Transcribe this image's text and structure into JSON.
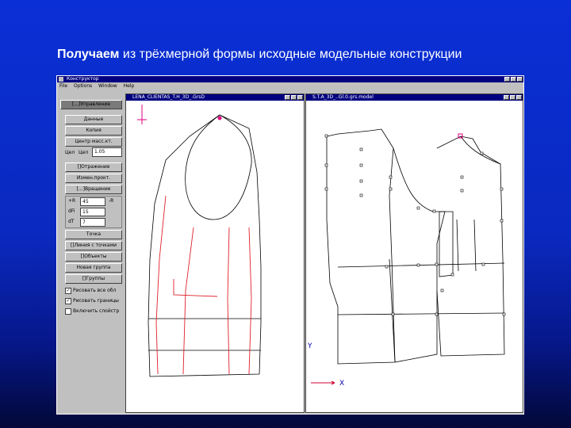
{
  "slide": {
    "title_bold": "Получаем",
    "title_rest": "из трёхмерной формы исходные модельные конструкции"
  },
  "app": {
    "window_title": "Конструктор",
    "menu": [
      "File",
      "Options",
      "Window",
      "Help"
    ],
    "left_view_title": "LENA_CLIENTAS_T.H_3D_.GrsD",
    "right_view_title": "S.T.A_3D_..Gl.0.grs.model"
  },
  "panel": {
    "management": "[...]Управление",
    "data": "Данные",
    "copy": "Копия",
    "center_mass": "Центр масс.кт.",
    "scale_label1": "Цел",
    "scale_label2": "Цел",
    "scale_value": "1.05",
    "reflection": "[]Отражение",
    "change_direction": "Измен.прокт.",
    "rotation": "[...]Вращение",
    "plus_r": "+R",
    "minus_r": "-R",
    "r_value": "45",
    "dfi_label": "dFi",
    "dfi_value": "15",
    "dt_label": "dT",
    "dt_value": "7",
    "point": "Точка",
    "line_by_points": "[]Линия с точками",
    "objects": "[]Объекты",
    "new_group": "Новая группа",
    "groups": "[]Группы",
    "check_draw_objects": "Рисовать все обл",
    "check_draw_borders": "Рисовать границы",
    "check_include_layers": "Включить слойстр"
  },
  "axes": {
    "y_label": "Y",
    "x_label": "X",
    "x_arrow_color": "#cc0033"
  },
  "colors": {
    "construction_line": "#000000",
    "model_line": "#e0202a",
    "marker": "#e00080"
  }
}
